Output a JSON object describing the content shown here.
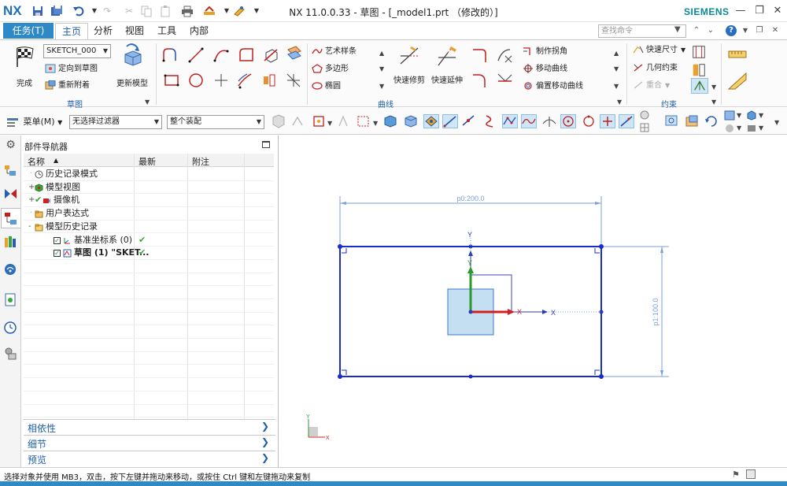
{
  "window": {
    "logo": "NX",
    "title": "NX 11.0.0.33 - 草图 - [_model1.prt （修改的）]",
    "brand": "SIEMENS"
  },
  "tabs": {
    "task": "任务(T)",
    "items": [
      "主页",
      "分析",
      "视图",
      "工具",
      "内部"
    ],
    "active_index": 0,
    "search_placeholder": "查找命令"
  },
  "ribbon": {
    "sketch_group": {
      "label": "草图",
      "finish": "完成",
      "sketch_name": "SKETCH_000",
      "orient": "定向到草图",
      "reattach": "重新附着",
      "update_model": "更新模型"
    },
    "curve_group": {
      "label": "曲线",
      "spline": "艺术样条",
      "polygon": "多边形",
      "ellipse": "椭圆",
      "quick_trim": "快速修剪",
      "quick_extend": "快速延伸",
      "make_corner": "制作拐角",
      "move_curve": "移动曲线",
      "offset_move": "偏置移动曲线"
    },
    "constraint_group": {
      "label": "约束",
      "quick_dim": "快速尺寸",
      "geo_constraint": "几何约束",
      "coincident": "重合"
    }
  },
  "toolbar2": {
    "menu": "菜单(M)",
    "filter": "无选择过滤器",
    "assembly": "整个装配"
  },
  "navigator": {
    "title": "部件导航器",
    "columns": [
      "名称",
      "最新",
      "附注"
    ],
    "rows": [
      {
        "label": "历史记录模式",
        "indent": 0,
        "expander": "",
        "check": false,
        "latest": ""
      },
      {
        "label": "模型视图",
        "indent": 0,
        "expander": "+",
        "check": false,
        "latest": ""
      },
      {
        "label": "摄像机",
        "indent": 0,
        "expander": "+",
        "check": true,
        "latest": ""
      },
      {
        "label": "用户表达式",
        "indent": 0,
        "expander": "",
        "check": false,
        "latest": ""
      },
      {
        "label": "模型历史记录",
        "indent": 0,
        "expander": "-",
        "check": false,
        "latest": ""
      },
      {
        "label": "基准坐标系 (0)",
        "indent": 1,
        "expander": "",
        "check": false,
        "latest": "✔"
      },
      {
        "label": "草图 (1) \"SKET...",
        "indent": 1,
        "expander": "",
        "check": false,
        "latest": "✔",
        "bold": true
      }
    ],
    "panels": [
      "相依性",
      "细节",
      "预览"
    ]
  },
  "graphics": {
    "dim_horizontal": "p0:200.0",
    "dim_vertical": "p1:100.0",
    "axis_x": "X",
    "axis_y": "Y"
  },
  "status": {
    "text": "选择对象并使用 MB3，双击，按下左键并拖动来移动，或按住 Ctrl 键和左键拖动来复制"
  },
  "colors": {
    "accent": "#2d89c8",
    "sketch": "#1a2ccc",
    "brand": "#0a8a96"
  }
}
